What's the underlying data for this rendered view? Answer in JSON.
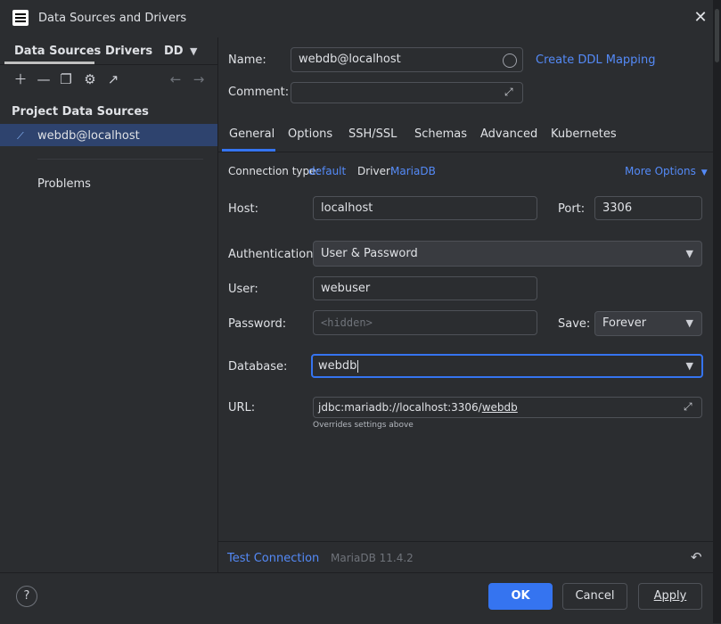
{
  "window": {
    "title": "Data Sources and Drivers"
  },
  "left": {
    "tabs": [
      "Data Sources",
      "Drivers",
      "DD"
    ],
    "section_title": "Project Data Sources",
    "datasource": "webdb@localhost",
    "problems": "Problems"
  },
  "form": {
    "name_label": "Name:",
    "name_value": "webdb@localhost",
    "create_ddl": "Create DDL Mapping",
    "comment_label": "Comment:",
    "comment_value": ""
  },
  "tabs": [
    "General",
    "Options",
    "SSH/SSL",
    "Schemas",
    "Advanced",
    "Kubernetes"
  ],
  "general": {
    "conn_type_label": "Connection type:",
    "conn_type_value": "default",
    "driver_label": "Driver:",
    "driver_value": "MariaDB",
    "more_options": "More Options",
    "host_label": "Host:",
    "host_value": "localhost",
    "port_label": "Port:",
    "port_value": "3306",
    "auth_label": "Authentication:",
    "auth_value": "User & Password",
    "user_label": "User:",
    "user_value": "webuser",
    "password_label": "Password:",
    "password_placeholder": "<hidden>",
    "save_label": "Save:",
    "save_value": "Forever",
    "database_label": "Database:",
    "database_value": "webdb",
    "url_label": "URL:",
    "url_prefix": "jdbc:mariadb://localhost:3306/",
    "url_db": "webdb",
    "url_note": "Overrides settings above"
  },
  "status": {
    "test_connection": "Test Connection",
    "version": "MariaDB 11.4.2"
  },
  "footer": {
    "help": "?",
    "ok": "OK",
    "cancel": "Cancel",
    "apply": "Apply"
  },
  "colors": {
    "accent": "#3574f0",
    "link": "#548af7",
    "selection": "#2e436e"
  }
}
